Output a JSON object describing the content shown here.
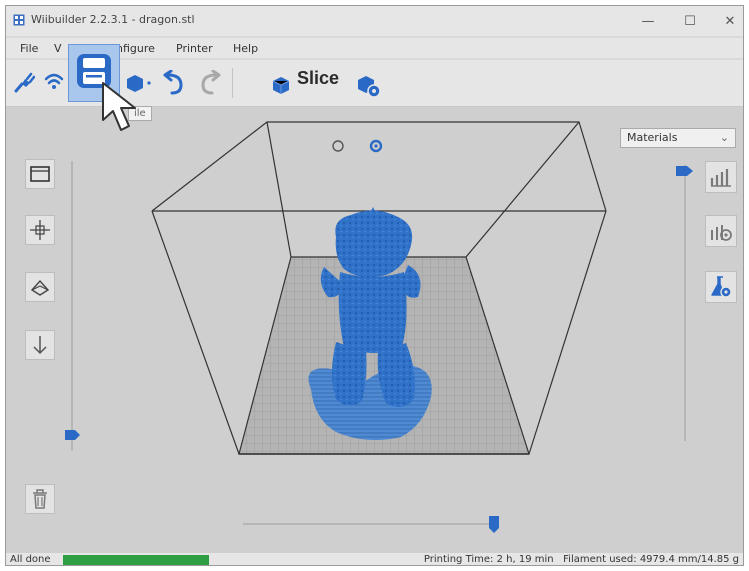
{
  "window": {
    "title": "Wiibuilder 2.2.3.1 - dragon.stl",
    "controls": [
      "—",
      "☐",
      "✕"
    ]
  },
  "menu": {
    "items": [
      "File",
      "V",
      "nfigure",
      "Printer",
      "Help"
    ]
  },
  "toolbar": {
    "slice_label": "Slice",
    "save_tooltip": "ile"
  },
  "materials_select": {
    "value": "Materials"
  },
  "status": {
    "text": "All done",
    "progress": 1.0,
    "printing_time_label": "Printing Time:",
    "printing_time": "2 h, 19 min",
    "filament_label": "Filament used:",
    "filament": "4979.4 mm/14.85 g"
  },
  "colors": {
    "accent": "#2a6ac6",
    "model": "#2f72c8",
    "progress": "#2ea043"
  },
  "icons": {
    "connect": "plug-icon",
    "wifi": "wifi-icon",
    "save": "floppy-disk-icon",
    "undo": "undo-icon",
    "redo": "redo-icon",
    "slice": "cube-icon",
    "slice_settings": "cube-gear-icon",
    "left_tools": [
      "view-box-icon",
      "move-icon",
      "rotate-icon",
      "drop-to-bed-icon",
      "trash-icon"
    ],
    "right_tools": [
      "layers-icon",
      "support-icon",
      "flask-icon"
    ]
  }
}
